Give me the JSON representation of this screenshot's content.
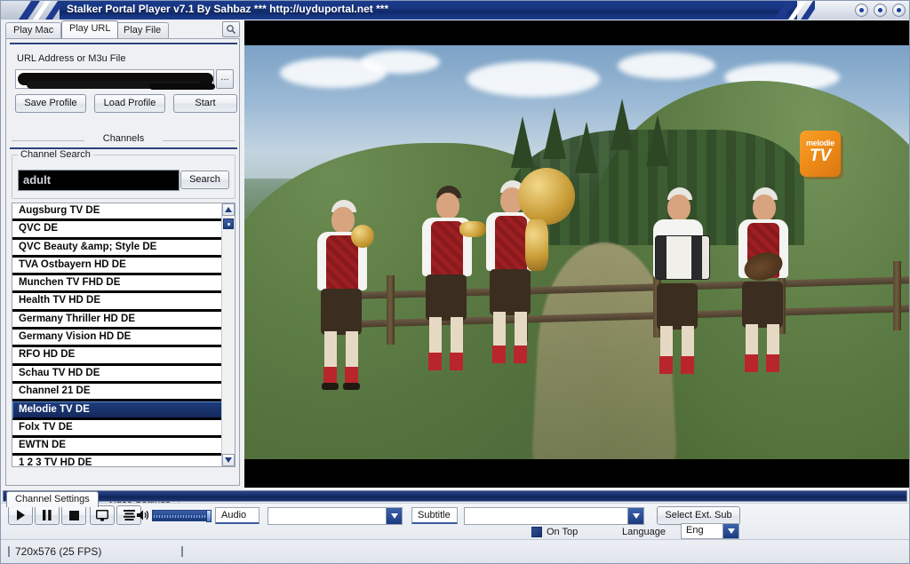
{
  "window": {
    "title": "Stalker Portal Player v7.1 By Sahbaz   *** http://uyduportal.net ***",
    "buttons": [
      "minimize",
      "maximize",
      "close"
    ]
  },
  "left_panel": {
    "tabs": [
      {
        "label": "Play Mac",
        "active": false
      },
      {
        "label": "Play URL",
        "active": true
      },
      {
        "label": "Play File",
        "active": false
      }
    ],
    "search_icon": "magnifier-icon",
    "url_group": {
      "label": "URL Address or M3u File",
      "value": "",
      "redacted": true,
      "browse_label": "..."
    },
    "profile_buttons": [
      {
        "label": "Save Profile"
      },
      {
        "label": "Load Profile"
      },
      {
        "label": "Start"
      }
    ],
    "channels_header": "Channels",
    "channel_search": {
      "group_label": "Channel Search",
      "value": "adult",
      "placeholder": "",
      "button_label": "Search"
    },
    "channel_list": [
      {
        "name": "Augsburg TV DE",
        "selected": false
      },
      {
        "name": "QVC DE",
        "selected": false
      },
      {
        "name": "QVC Beauty &amp; Style DE",
        "selected": false
      },
      {
        "name": "TVA Ostbayern HD DE",
        "selected": false
      },
      {
        "name": "Munchen TV FHD DE",
        "selected": false
      },
      {
        "name": "Health TV HD DE",
        "selected": false
      },
      {
        "name": "Germany Thriller HD DE",
        "selected": false
      },
      {
        "name": "Germany Vision HD DE",
        "selected": false
      },
      {
        "name": "RFO HD DE",
        "selected": false
      },
      {
        "name": "Schau TV HD DE",
        "selected": false
      },
      {
        "name": "Channel 21 DE",
        "selected": false
      },
      {
        "name": "Melodie TV DE",
        "selected": true
      },
      {
        "name": "Folx TV DE",
        "selected": false
      },
      {
        "name": "EWTN DE",
        "selected": false
      },
      {
        "name": "1 2 3 TV HD DE",
        "selected": false
      }
    ],
    "bottom_tabs": [
      {
        "label": "Channel Settings",
        "active": true
      },
      {
        "label": "Video Settings",
        "active": false
      }
    ]
  },
  "video": {
    "channel_logo": {
      "line1": "melodie",
      "line2": "TV",
      "color": "#ef8c19"
    },
    "letterboxed": true
  },
  "seek": {
    "position": 0
  },
  "controls": {
    "play_icon": "play-icon",
    "pause_icon": "pause-icon",
    "stop_icon": "stop-icon",
    "screen_icon": "monitor-icon",
    "playlist_icon": "playlist-icon",
    "volume_icon": "volume-icon",
    "volume_level": 100,
    "audio_label": "Audio",
    "audio_track_value": "",
    "subtitle_label": "Subtitle",
    "subtitle_track_value": "",
    "select_ext_sub_label": "Select Ext. Sub",
    "on_top_label": "On Top",
    "on_top_checked": true,
    "language_label": "Language",
    "language_value": "Eng"
  },
  "status": {
    "resolution_fps": "720x576  (25 FPS)",
    "panel2": ""
  }
}
